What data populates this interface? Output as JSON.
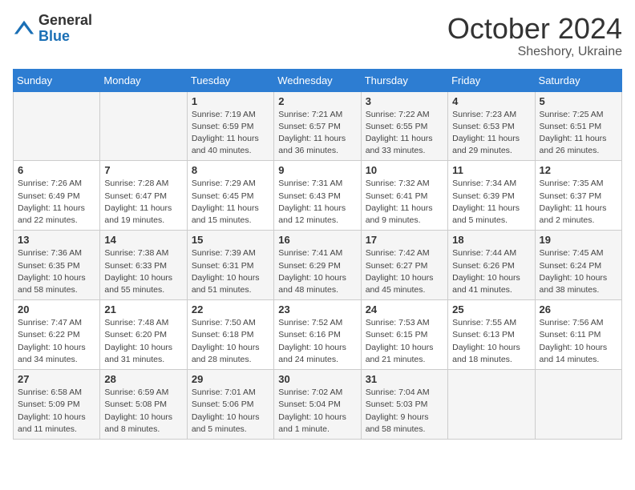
{
  "header": {
    "logo_general": "General",
    "logo_blue": "Blue",
    "month_year": "October 2024",
    "location": "Sheshory, Ukraine"
  },
  "days_of_week": [
    "Sunday",
    "Monday",
    "Tuesday",
    "Wednesday",
    "Thursday",
    "Friday",
    "Saturday"
  ],
  "weeks": [
    [
      {
        "day": "",
        "info": ""
      },
      {
        "day": "",
        "info": ""
      },
      {
        "day": "1",
        "info": "Sunrise: 7:19 AM\nSunset: 6:59 PM\nDaylight: 11 hours and 40 minutes."
      },
      {
        "day": "2",
        "info": "Sunrise: 7:21 AM\nSunset: 6:57 PM\nDaylight: 11 hours and 36 minutes."
      },
      {
        "day": "3",
        "info": "Sunrise: 7:22 AM\nSunset: 6:55 PM\nDaylight: 11 hours and 33 minutes."
      },
      {
        "day": "4",
        "info": "Sunrise: 7:23 AM\nSunset: 6:53 PM\nDaylight: 11 hours and 29 minutes."
      },
      {
        "day": "5",
        "info": "Sunrise: 7:25 AM\nSunset: 6:51 PM\nDaylight: 11 hours and 26 minutes."
      }
    ],
    [
      {
        "day": "6",
        "info": "Sunrise: 7:26 AM\nSunset: 6:49 PM\nDaylight: 11 hours and 22 minutes."
      },
      {
        "day": "7",
        "info": "Sunrise: 7:28 AM\nSunset: 6:47 PM\nDaylight: 11 hours and 19 minutes."
      },
      {
        "day": "8",
        "info": "Sunrise: 7:29 AM\nSunset: 6:45 PM\nDaylight: 11 hours and 15 minutes."
      },
      {
        "day": "9",
        "info": "Sunrise: 7:31 AM\nSunset: 6:43 PM\nDaylight: 11 hours and 12 minutes."
      },
      {
        "day": "10",
        "info": "Sunrise: 7:32 AM\nSunset: 6:41 PM\nDaylight: 11 hours and 9 minutes."
      },
      {
        "day": "11",
        "info": "Sunrise: 7:34 AM\nSunset: 6:39 PM\nDaylight: 11 hours and 5 minutes."
      },
      {
        "day": "12",
        "info": "Sunrise: 7:35 AM\nSunset: 6:37 PM\nDaylight: 11 hours and 2 minutes."
      }
    ],
    [
      {
        "day": "13",
        "info": "Sunrise: 7:36 AM\nSunset: 6:35 PM\nDaylight: 10 hours and 58 minutes."
      },
      {
        "day": "14",
        "info": "Sunrise: 7:38 AM\nSunset: 6:33 PM\nDaylight: 10 hours and 55 minutes."
      },
      {
        "day": "15",
        "info": "Sunrise: 7:39 AM\nSunset: 6:31 PM\nDaylight: 10 hours and 51 minutes."
      },
      {
        "day": "16",
        "info": "Sunrise: 7:41 AM\nSunset: 6:29 PM\nDaylight: 10 hours and 48 minutes."
      },
      {
        "day": "17",
        "info": "Sunrise: 7:42 AM\nSunset: 6:27 PM\nDaylight: 10 hours and 45 minutes."
      },
      {
        "day": "18",
        "info": "Sunrise: 7:44 AM\nSunset: 6:26 PM\nDaylight: 10 hours and 41 minutes."
      },
      {
        "day": "19",
        "info": "Sunrise: 7:45 AM\nSunset: 6:24 PM\nDaylight: 10 hours and 38 minutes."
      }
    ],
    [
      {
        "day": "20",
        "info": "Sunrise: 7:47 AM\nSunset: 6:22 PM\nDaylight: 10 hours and 34 minutes."
      },
      {
        "day": "21",
        "info": "Sunrise: 7:48 AM\nSunset: 6:20 PM\nDaylight: 10 hours and 31 minutes."
      },
      {
        "day": "22",
        "info": "Sunrise: 7:50 AM\nSunset: 6:18 PM\nDaylight: 10 hours and 28 minutes."
      },
      {
        "day": "23",
        "info": "Sunrise: 7:52 AM\nSunset: 6:16 PM\nDaylight: 10 hours and 24 minutes."
      },
      {
        "day": "24",
        "info": "Sunrise: 7:53 AM\nSunset: 6:15 PM\nDaylight: 10 hours and 21 minutes."
      },
      {
        "day": "25",
        "info": "Sunrise: 7:55 AM\nSunset: 6:13 PM\nDaylight: 10 hours and 18 minutes."
      },
      {
        "day": "26",
        "info": "Sunrise: 7:56 AM\nSunset: 6:11 PM\nDaylight: 10 hours and 14 minutes."
      }
    ],
    [
      {
        "day": "27",
        "info": "Sunrise: 6:58 AM\nSunset: 5:09 PM\nDaylight: 10 hours and 11 minutes."
      },
      {
        "day": "28",
        "info": "Sunrise: 6:59 AM\nSunset: 5:08 PM\nDaylight: 10 hours and 8 minutes."
      },
      {
        "day": "29",
        "info": "Sunrise: 7:01 AM\nSunset: 5:06 PM\nDaylight: 10 hours and 5 minutes."
      },
      {
        "day": "30",
        "info": "Sunrise: 7:02 AM\nSunset: 5:04 PM\nDaylight: 10 hours and 1 minute."
      },
      {
        "day": "31",
        "info": "Sunrise: 7:04 AM\nSunset: 5:03 PM\nDaylight: 9 hours and 58 minutes."
      },
      {
        "day": "",
        "info": ""
      },
      {
        "day": "",
        "info": ""
      }
    ]
  ]
}
